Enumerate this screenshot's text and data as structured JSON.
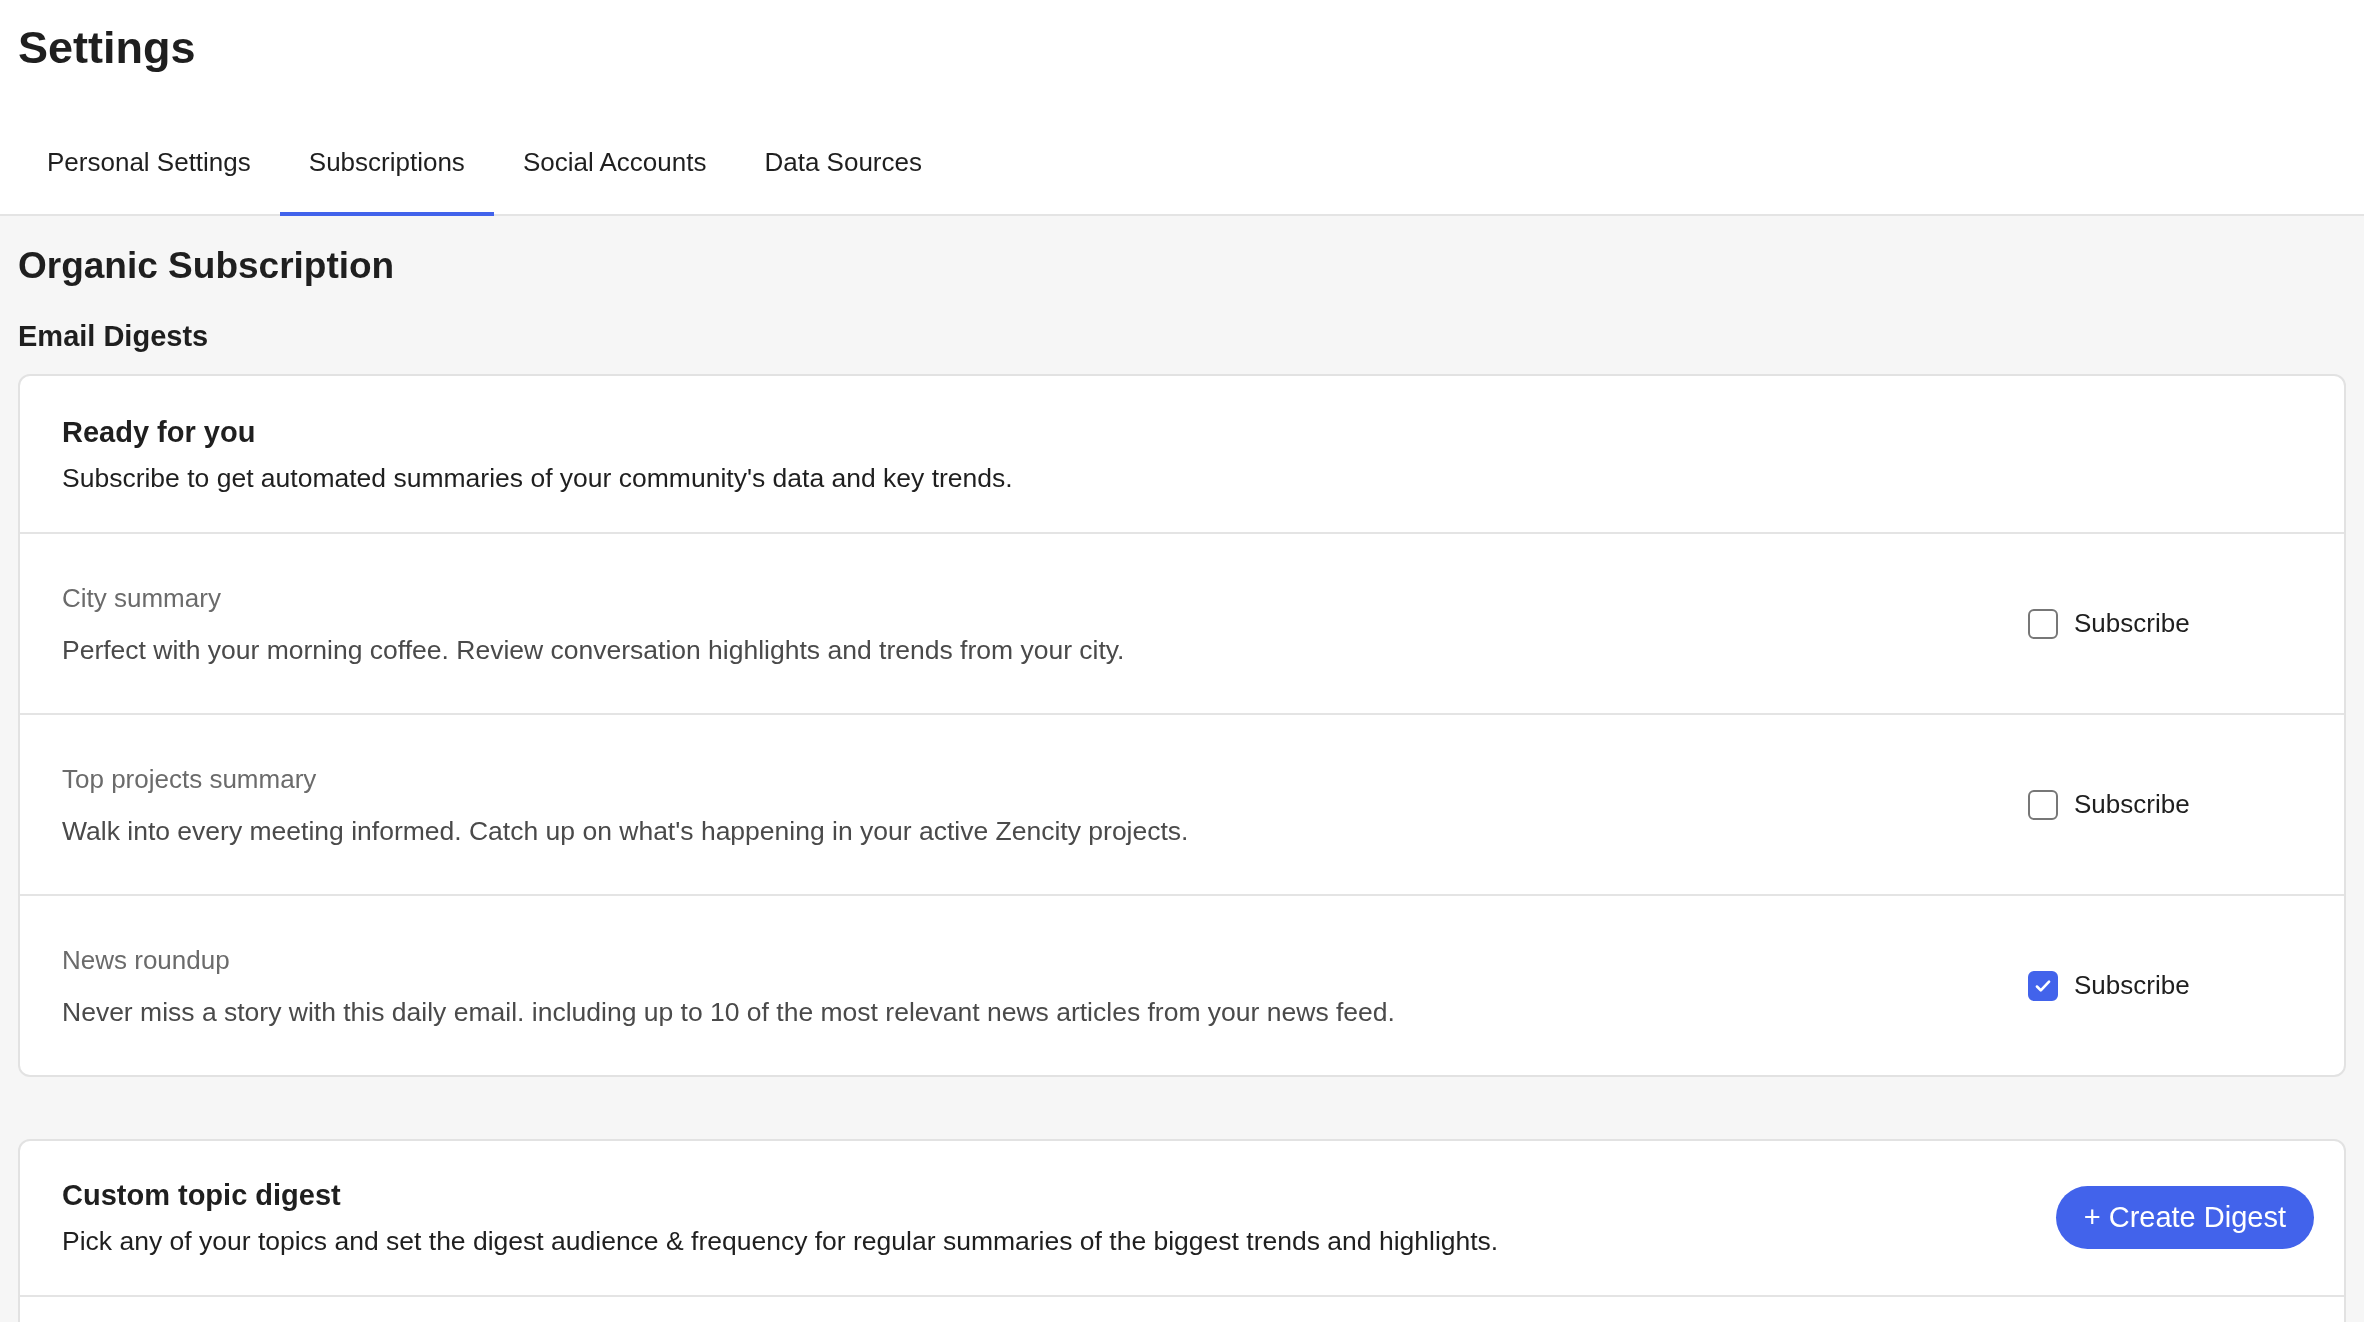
{
  "page": {
    "title": "Settings"
  },
  "tabs": [
    {
      "label": "Personal Settings",
      "selected": false
    },
    {
      "label": "Subscriptions",
      "selected": true
    },
    {
      "label": "Social Accounts",
      "selected": false
    },
    {
      "label": "Data Sources",
      "selected": false
    }
  ],
  "section": {
    "title": "Organic Subscription",
    "subtitle": "Email Digests"
  },
  "ready_card": {
    "title": "Ready for you",
    "description": "Subscribe to get automated summaries of your community's data and key trends.",
    "digests": [
      {
        "name": "City summary",
        "description": "Perfect with your morning coffee. Review conversation highlights and trends from your city.",
        "label": "Subscribe",
        "checked": false
      },
      {
        "name": "Top projects summary",
        "description": "Walk into every meeting informed. Catch up on what's happening in your active Zencity projects.",
        "label": "Subscribe",
        "checked": false
      },
      {
        "name": "News roundup",
        "description": "Never miss a story with this daily email. including up to 10 of the most relevant news articles from your news feed.",
        "label": "Subscribe",
        "checked": true
      }
    ]
  },
  "custom_card": {
    "title": "Custom topic digest",
    "description": "Pick any of your topics and set the digest audience & frequency for regular summaries of the biggest trends and highlights.",
    "button": "+ Create Digest"
  }
}
